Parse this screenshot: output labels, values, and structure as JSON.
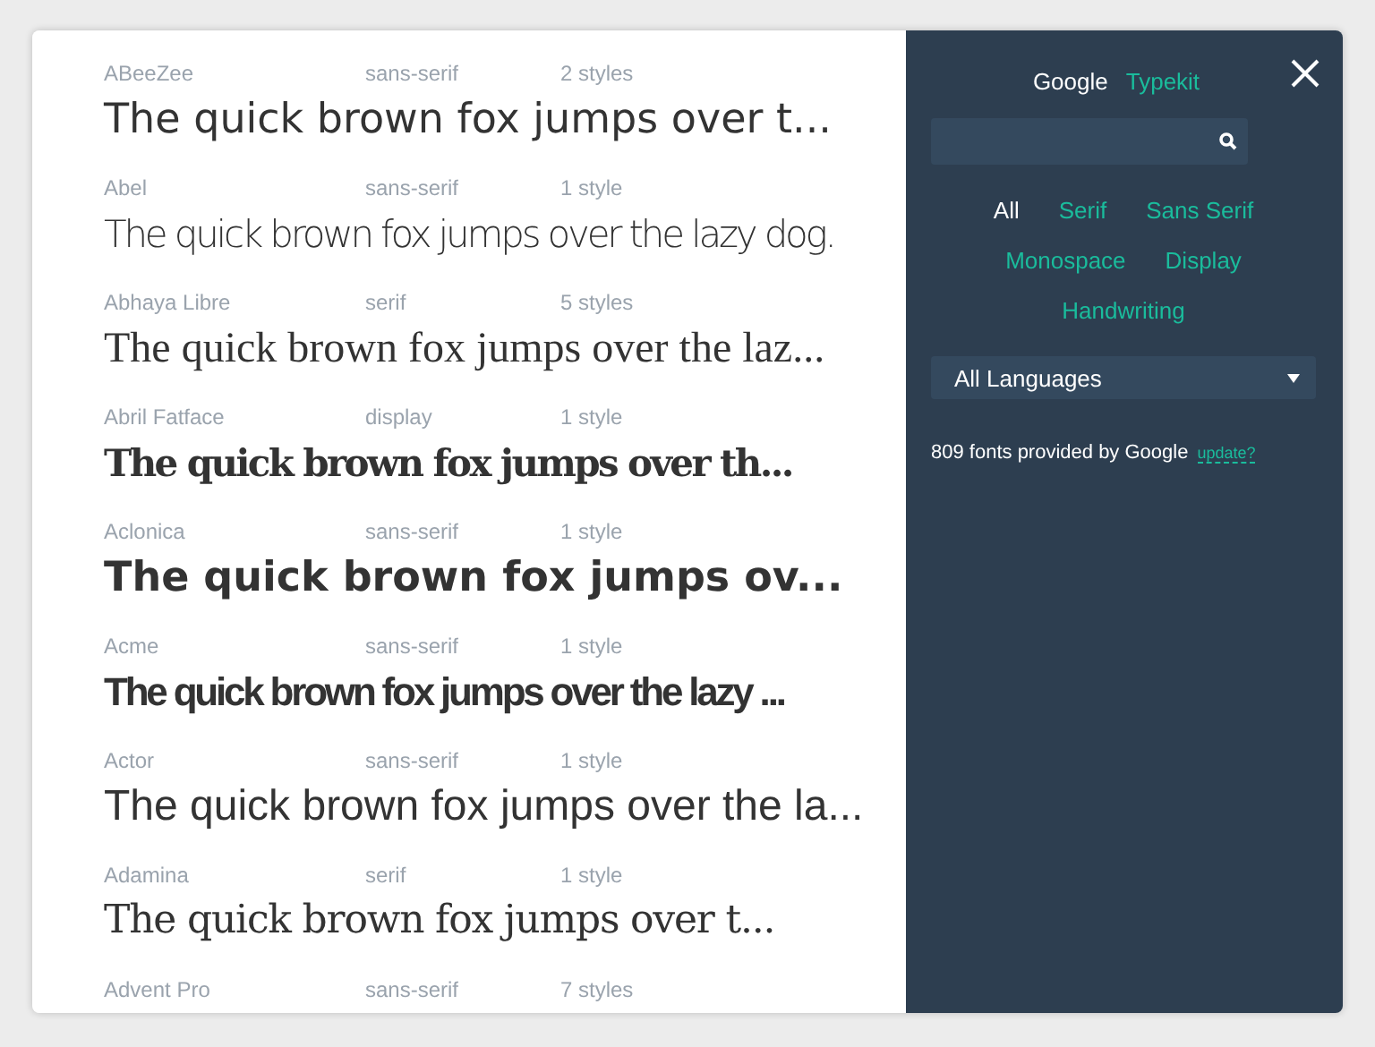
{
  "fonts": [
    {
      "name": "ABeeZee",
      "category": "sans-serif",
      "styles": "2 styles",
      "kind": "sans",
      "sample": "The quick brown fox jumps over t..."
    },
    {
      "name": "Abel",
      "category": "sans-serif",
      "styles": "1 style",
      "kind": "condensed",
      "sample": "The quick brown fox jumps over the lazy dog."
    },
    {
      "name": "Abhaya Libre",
      "category": "serif",
      "styles": "5 styles",
      "kind": "serif",
      "sample": "The quick brown fox jumps over the laz..."
    },
    {
      "name": "Abril Fatface",
      "category": "display",
      "styles": "1 style",
      "kind": "fat-serif",
      "sample": "The quick brown fox jumps over th..."
    },
    {
      "name": "Aclonica",
      "category": "sans-serif",
      "styles": "1 style",
      "kind": "wide-bold",
      "sample": "The quick brown fox jumps ov..."
    },
    {
      "name": "Acme",
      "category": "sans-serif",
      "styles": "1 style",
      "kind": "bold-condensed",
      "sample": "The quick brown fox jumps over the lazy ..."
    },
    {
      "name": "Actor",
      "category": "sans-serif",
      "styles": "1 style",
      "kind": "sans-light",
      "sample": "The quick brown fox jumps over the la..."
    },
    {
      "name": "Adamina",
      "category": "serif",
      "styles": "1 style",
      "kind": "serif-large",
      "sample": "The quick brown fox jumps over t..."
    },
    {
      "name": "Advent Pro",
      "category": "sans-serif",
      "styles": "7 styles"
    }
  ],
  "sources": [
    {
      "label": "Google",
      "selected": true
    },
    {
      "label": "Typekit",
      "selected": false
    }
  ],
  "categories": [
    {
      "label": "All",
      "selected": true
    },
    {
      "label": "Serif",
      "selected": false
    },
    {
      "label": "Sans Serif",
      "selected": false
    },
    {
      "label": "Monospace",
      "selected": false
    },
    {
      "label": "Display",
      "selected": false
    },
    {
      "label": "Handwriting",
      "selected": false
    }
  ],
  "language": {
    "value": "All Languages"
  },
  "info": {
    "text": "809 fonts provided by Google",
    "link": "update?"
  }
}
